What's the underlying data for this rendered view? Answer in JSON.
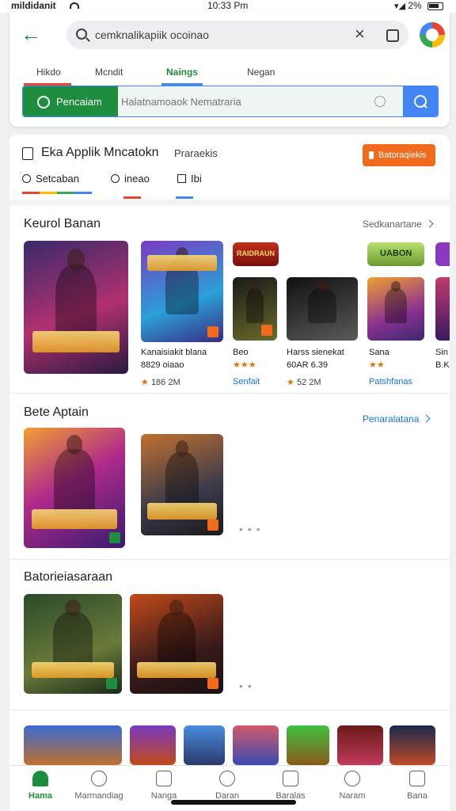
{
  "status_bar": {
    "carrier": "mildidanit",
    "time": "10:33 Pm",
    "battery": "2%"
  },
  "header": {
    "search_query": "cemknalikapiik ocoinao",
    "tabs": [
      "Hikdo",
      "Mcndit",
      "Naings",
      "Negan"
    ],
    "active_tab": "Naings",
    "search_button": "Pencaiam",
    "search_placeholder": "Halatnamoaok Nematraria"
  },
  "app_section": {
    "title": "Eka Applik Mncatokn",
    "subtitle": "Praraekis",
    "action_button": "Batoraqiekis",
    "chips": [
      "Setcaban",
      "ineao",
      "Ibi"
    ]
  },
  "sections": [
    {
      "title": "Keurol Banan",
      "link": "Sedkanartane",
      "games": [
        {
          "name": "",
          "meta": ""
        },
        {
          "name": "Kanaisiakit blana",
          "name2": "8829 oiaao",
          "rating": "★",
          "meta": "186 2M"
        },
        {
          "name": "Beo",
          "rating": "★★★",
          "meta": "Senfait"
        },
        {
          "name": "Harss sienekat",
          "name2": "60AR 6.39",
          "rating": "★",
          "meta": "52 2M"
        },
        {
          "name": "Sana",
          "rating": "★★",
          "meta": "Patshfanas"
        },
        {
          "name": "Sin",
          "name2": "B.K",
          "rating": "★"
        }
      ],
      "header_tags": [
        "RAIDRAUN",
        "UABON"
      ]
    },
    {
      "title": "Bete Aptain",
      "link": "Penaralatana"
    },
    {
      "title": "Batorieiasaraan"
    }
  ],
  "bottom_nav": [
    "Hama",
    "Marmandiag",
    "Nanga",
    "Daran",
    "Baralas",
    "Naram",
    "Bana"
  ],
  "active_nav": "Hama",
  "colors": {
    "accent_green": "#1e8e3e",
    "accent_blue": "#4285f4",
    "accent_orange": "#f26a1b"
  }
}
